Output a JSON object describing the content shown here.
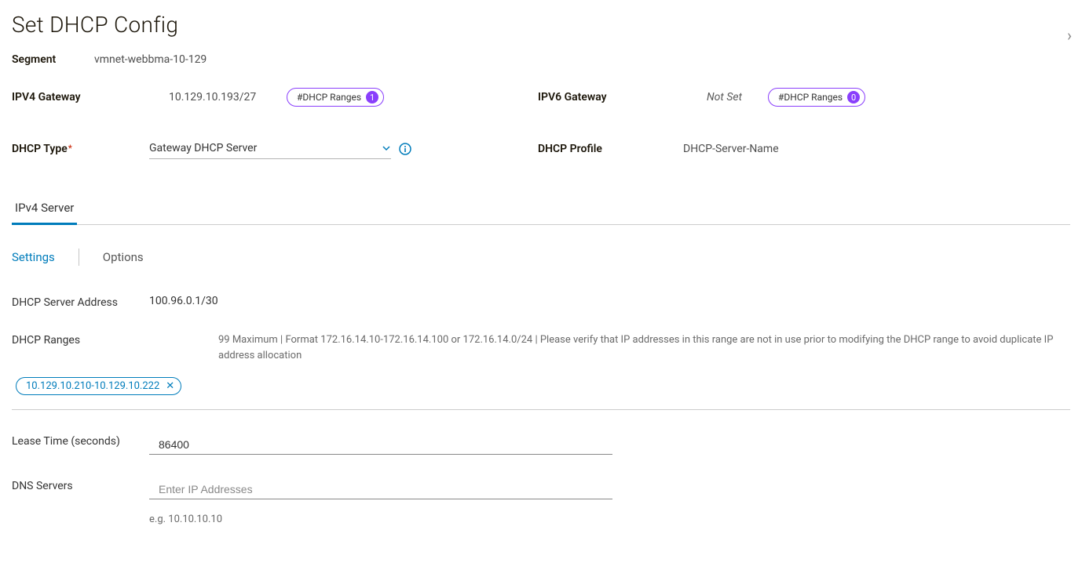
{
  "title": "Set DHCP Config",
  "segment": {
    "label": "Segment",
    "value": "vmnet-webbma-10-129"
  },
  "ipv4_gateway": {
    "label": "IPV4 Gateway",
    "value": "10.129.10.193/27",
    "pill_label": "#DHCP Ranges",
    "pill_count": "1"
  },
  "ipv6_gateway": {
    "label": "IPV6 Gateway",
    "value": "Not Set",
    "pill_label": "#DHCP Ranges",
    "pill_count": "0"
  },
  "dhcp_type": {
    "label": "DHCP Type",
    "value": "Gateway DHCP Server"
  },
  "dhcp_profile": {
    "label": "DHCP Profile",
    "value": "DHCP-Server-Name"
  },
  "tabs": {
    "ipv4": "IPv4 Server"
  },
  "subtabs": {
    "settings": "Settings",
    "options": "Options"
  },
  "server_address": {
    "label": "DHCP Server Address",
    "value": "100.96.0.1/30"
  },
  "ranges": {
    "label": "DHCP Ranges",
    "help": "99 Maximum | Format 172.16.14.10-172.16.14.100 or 172.16.14.0/24 | Please verify that IP addresses in this range are not in use prior to modifying the DHCP range to avoid duplicate IP address allocation",
    "chip": "10.129.10.210-10.129.10.222"
  },
  "lease_time": {
    "label": "Lease Time (seconds)",
    "value": "86400"
  },
  "dns_servers": {
    "label": "DNS Servers",
    "placeholder": "Enter IP Addresses",
    "helper": "e.g. 10.10.10.10"
  }
}
